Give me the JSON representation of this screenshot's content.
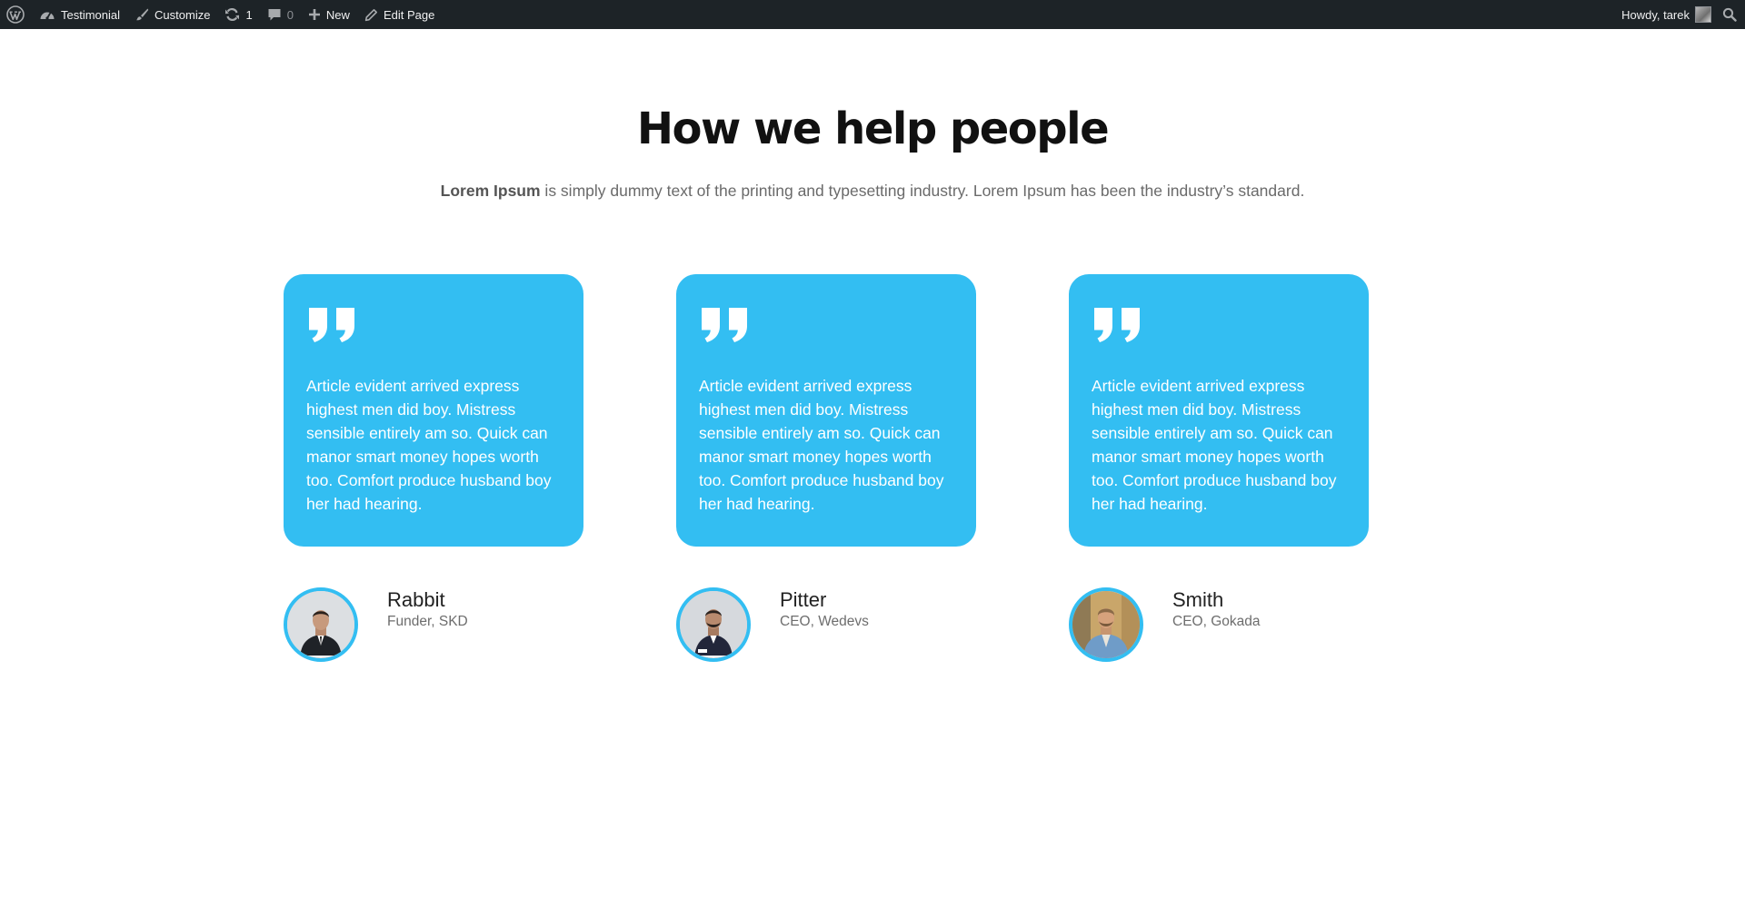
{
  "adminbar": {
    "site_name": "Testimonial",
    "customize": "Customize",
    "updates_count": "1",
    "comments_count": "0",
    "new": "New",
    "edit_page": "Edit Page",
    "howdy": "Howdy, tarek"
  },
  "section": {
    "heading": "How we help people",
    "subtitle_bold": "Lorem Ipsum",
    "subtitle_rest": " is simply dummy text of the printing and typesetting industry. Lorem Ipsum has been the industry’s standard."
  },
  "testimonials": [
    {
      "quote": "Article evident arrived express highest men did boy. Mistress sensible entirely am so. Quick can manor smart money hopes worth too. Comfort produce husband boy her had hearing.",
      "name": "Rabbit",
      "role": "Funder, SKD"
    },
    {
      "quote": "Article evident arrived express highest men did boy. Mistress sensible entirely am so. Quick can manor smart money hopes worth too. Comfort produce husband boy her had hearing.",
      "name": "Pitter",
      "role": "CEO, Wedevs"
    },
    {
      "quote": "Article evident arrived express highest men did boy. Mistress sensible entirely am so. Quick can manor smart money hopes worth too. Comfort produce husband boy her had hearing.",
      "name": "Smith",
      "role": "CEO, Gokada"
    }
  ],
  "colors": {
    "accent": "#33bef2",
    "adminbar_bg": "#1d2327",
    "heading": "#111111",
    "body_text": "#6a6a6a"
  },
  "icons": {
    "adminbar": [
      "wordpress-logo-icon",
      "dashboard-icon",
      "brush-icon",
      "updates-icon",
      "comment-icon",
      "plus-icon",
      "pencil-icon",
      "search-icon"
    ],
    "card": "quote-icon"
  }
}
